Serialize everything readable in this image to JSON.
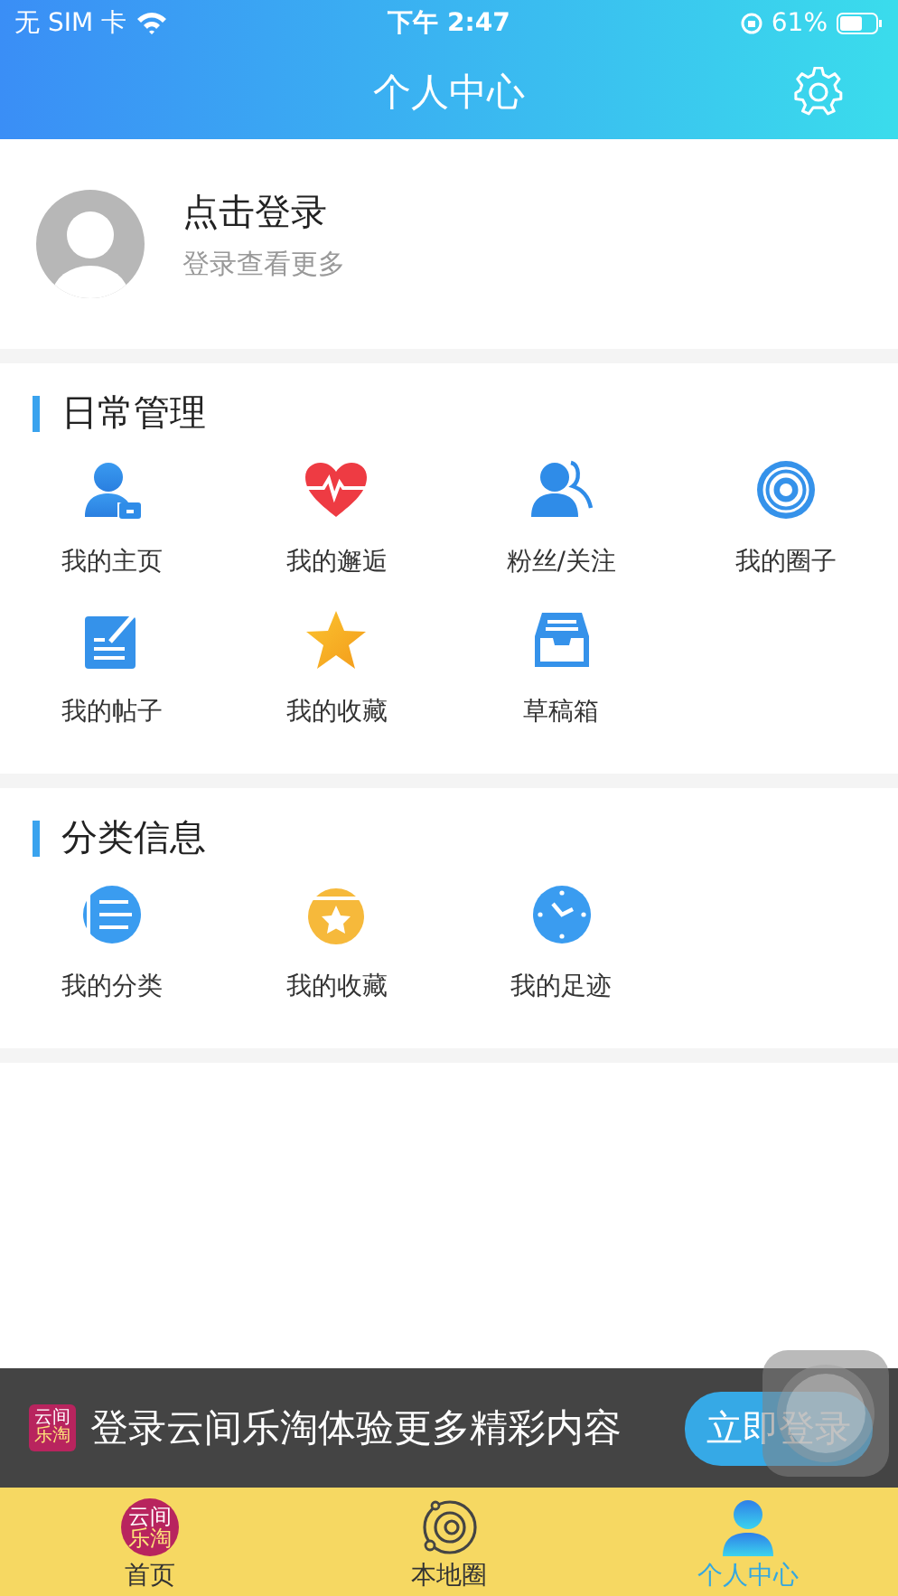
{
  "status_bar": {
    "carrier": "无 SIM 卡",
    "time": "下午 2:47",
    "battery": "61%"
  },
  "nav_bar": {
    "title": "个人中心"
  },
  "profile": {
    "name": "点击登录",
    "subtitle": "登录查看更多"
  },
  "sections": [
    {
      "title": "日常管理",
      "items": [
        {
          "label": "我的主页"
        },
        {
          "label": "我的邂逅"
        },
        {
          "label": "粉丝/关注"
        },
        {
          "label": "我的圈子"
        },
        {
          "label": "我的帖子"
        },
        {
          "label": "我的收藏"
        },
        {
          "label": "草稿箱"
        }
      ]
    },
    {
      "title": "分类信息",
      "items": [
        {
          "label": "我的分类"
        },
        {
          "label": "我的收藏"
        },
        {
          "label": "我的足迹"
        }
      ]
    }
  ],
  "login_banner": {
    "logo_text": [
      "云间",
      "乐淘"
    ],
    "message": "登录云间乐淘体验更多精彩内容",
    "button": "立即登录"
  },
  "tab_bar": [
    {
      "label": "首页",
      "logo_text": [
        "云间",
        "乐淘"
      ],
      "selected": false
    },
    {
      "label": "本地圈",
      "selected": false
    },
    {
      "label": "个人中心",
      "selected": true
    }
  ]
}
